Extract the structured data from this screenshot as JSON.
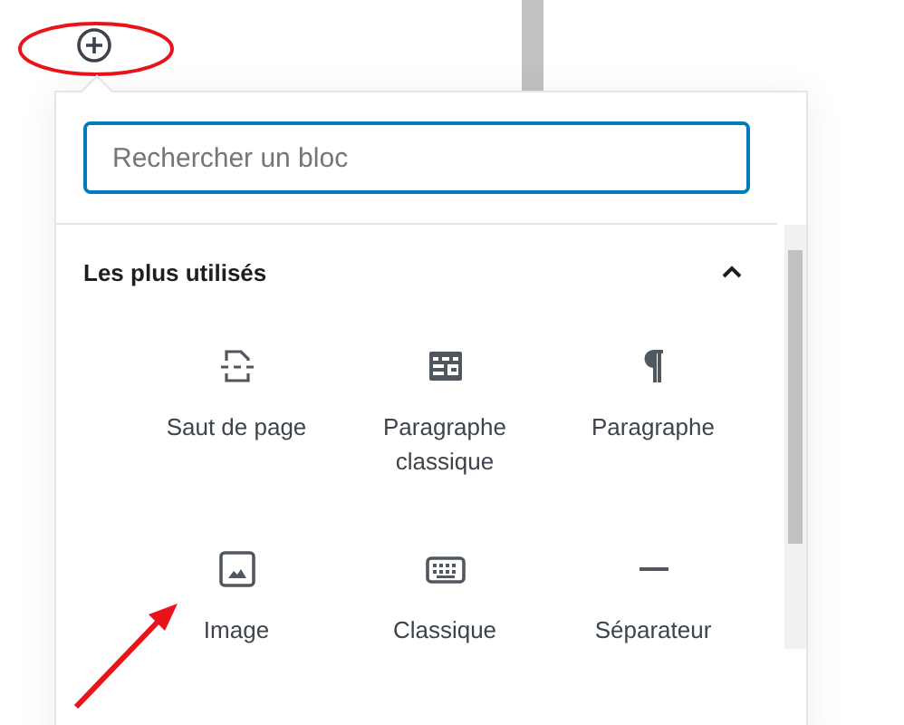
{
  "inserter": {
    "search": {
      "placeholder": "Rechercher un bloc"
    },
    "section": {
      "title": "Les plus utilisés",
      "expanded": true
    },
    "blocks": [
      {
        "label": "Saut de page",
        "kind": "page-break"
      },
      {
        "label": "Paragraphe classique",
        "kind": "classic-paragraph"
      },
      {
        "label": "Paragraphe",
        "kind": "paragraph"
      },
      {
        "label": "Image",
        "kind": "image"
      },
      {
        "label": "Classique",
        "kind": "keyboard"
      },
      {
        "label": "Séparateur",
        "kind": "separator"
      }
    ]
  }
}
